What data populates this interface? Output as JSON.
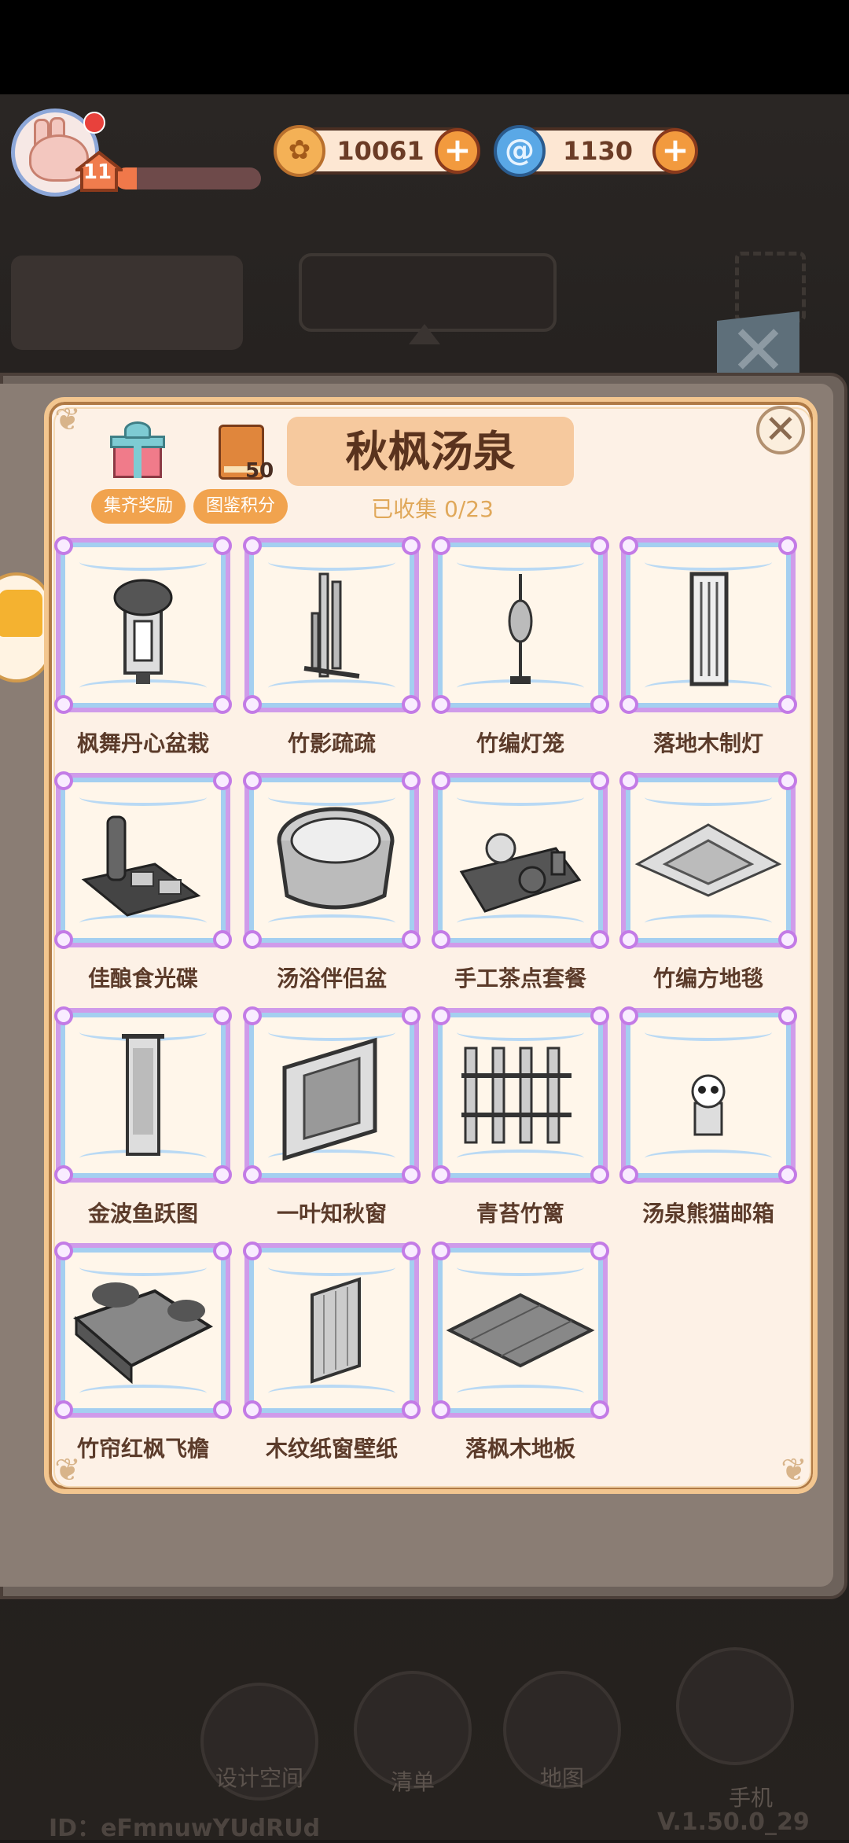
{
  "hud": {
    "level": "11",
    "xp_fraction": 0.15,
    "coins": "10061",
    "swirls": "1130",
    "coin_icon": "coin-icon",
    "swirl_icon": "spiral-icon",
    "plus_symbol": "+"
  },
  "panel": {
    "title": "秋枫汤泉",
    "reward_label": "集齐奖励",
    "score_label": "图鉴积分",
    "score_value": "50",
    "collected": "已收集 0/23",
    "close_symbol": "✕"
  },
  "items": [
    {
      "name": "枫舞丹心盆栽",
      "icon": "potted-plant-icon"
    },
    {
      "name": "竹影疏疏",
      "icon": "bamboo-icon"
    },
    {
      "name": "竹编灯笼",
      "icon": "lantern-icon"
    },
    {
      "name": "落地木制灯",
      "icon": "floor-lamp-icon"
    },
    {
      "name": "佳酿食光碟",
      "icon": "sake-tray-icon"
    },
    {
      "name": "汤浴伴侣盆",
      "icon": "wooden-tub-icon"
    },
    {
      "name": "手工茶点套餐",
      "icon": "tea-set-icon"
    },
    {
      "name": "竹编方地毯",
      "icon": "square-rug-icon"
    },
    {
      "name": "金波鱼跃图",
      "icon": "hanging-scroll-icon"
    },
    {
      "name": "一叶知秋窗",
      "icon": "window-icon"
    },
    {
      "name": "青苔竹篱",
      "icon": "bamboo-fence-icon"
    },
    {
      "name": "汤泉熊猫邮箱",
      "icon": "panda-mailbox-icon"
    },
    {
      "name": "竹帘红枫飞檐",
      "icon": "roof-eave-icon"
    },
    {
      "name": "木纹纸窗壁纸",
      "icon": "wallpaper-icon"
    },
    {
      "name": "落枫木地板",
      "icon": "wood-floor-icon"
    }
  ],
  "bottom_nav": [
    {
      "label": "设计空间",
      "icon": "design-icon"
    },
    {
      "label": "清单",
      "icon": "checklist-icon"
    },
    {
      "label": "地图",
      "icon": "map-pin-icon"
    },
    {
      "label": "手机",
      "icon": "phone-icon"
    }
  ],
  "footer": {
    "id": "ID：eFmnuwYUdRUd",
    "version": "V.1.50.0_29"
  }
}
